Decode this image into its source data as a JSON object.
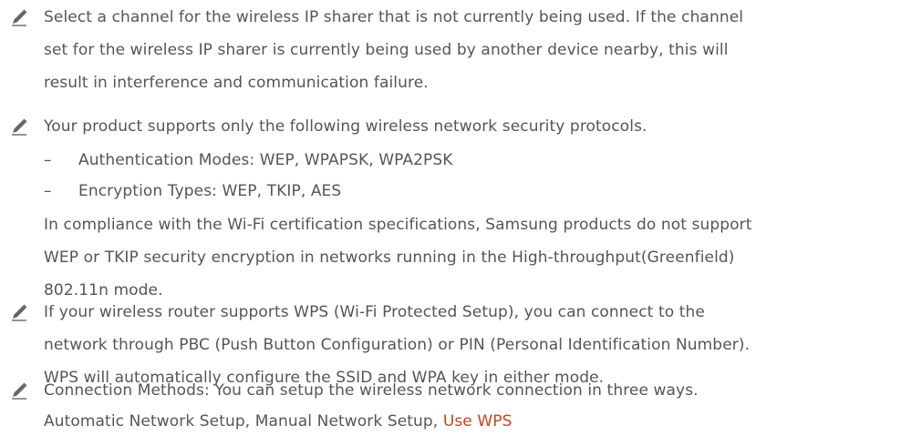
{
  "notes": [
    {
      "lines": [
        "Select a channel for the wireless IP sharer that is not currently being used. If the channel",
        "set for the wireless IP sharer is currently being used by another device nearby, this will",
        "result in interference and communication failure."
      ]
    },
    {
      "intro": "Your product supports only the following wireless network security protocols.",
      "sublist": [
        {
          "dash": "–",
          "text": "Authentication Modes: WEP, WPAPSK, WPA2PSK"
        },
        {
          "dash": "–",
          "text": "Encryption Types: WEP, TKIP, AES"
        }
      ],
      "lines": [
        "In compliance with the Wi-Fi certification specifications, Samsung products do not support",
        "WEP or TKIP security encryption in networks running in the High-throughput(Greenfield)",
        "802.11n mode."
      ]
    },
    {
      "lines": [
        "If your wireless router supports WPS (Wi-Fi Protected Setup), you can connect to the",
        "network through PBC (Push Button Configuration) or PIN (Personal Identification Number).",
        "WPS will automatically configure the SSID and WPA key in either mode."
      ]
    },
    {
      "line1": "Connection Methods: You can setup the wireless network connection in three ways.",
      "line2_prefix": "Automatic Network Setup, Manual Network Setup, ",
      "link": "Use WPS"
    }
  ],
  "colors": {
    "text": "#555555",
    "link": "#c7431f",
    "icon": "#666666"
  },
  "icon_name": "pencil-icon"
}
